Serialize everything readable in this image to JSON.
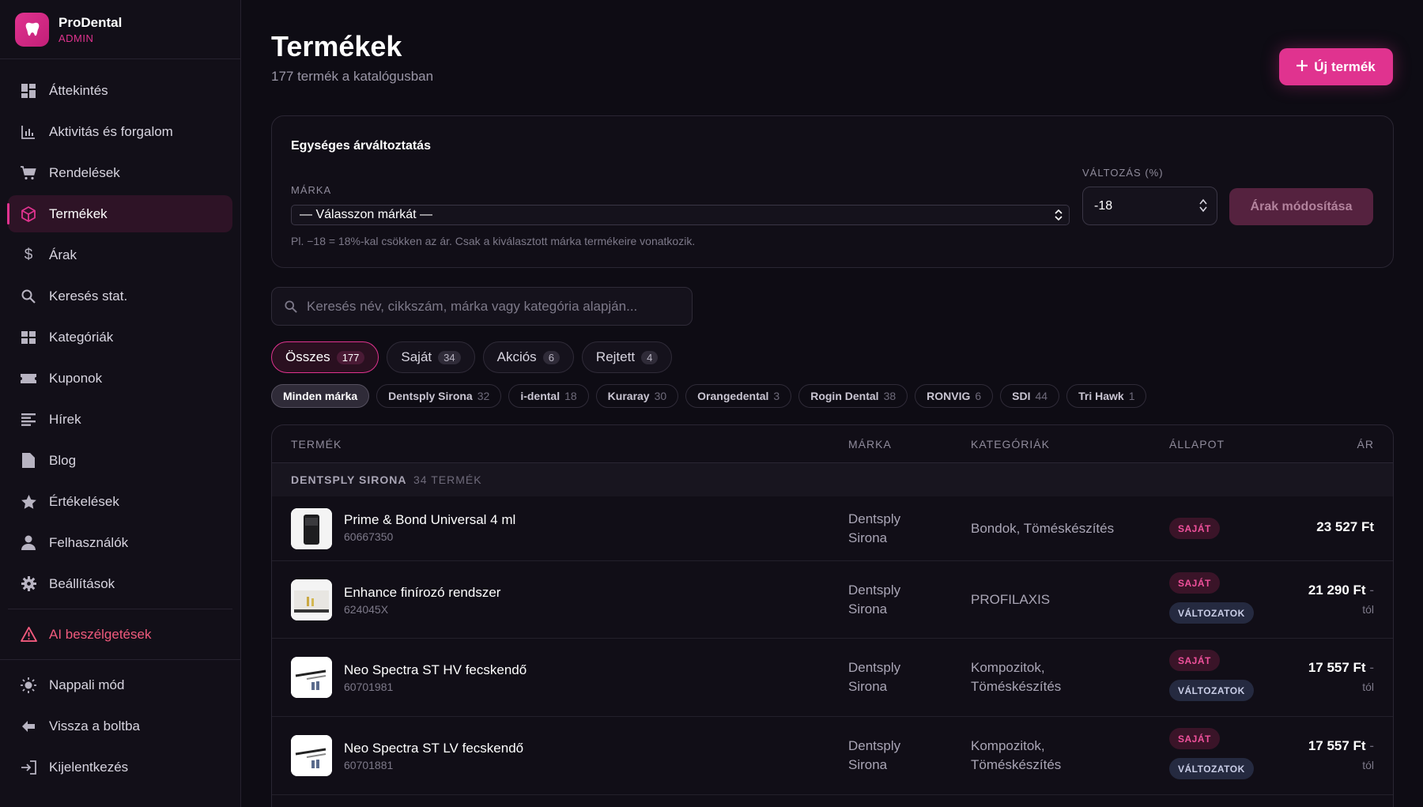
{
  "brand": {
    "name": "ProDental",
    "sub": "ADMIN"
  },
  "nav": [
    {
      "label": "Áttekintés",
      "icon": "dashboard-icon"
    },
    {
      "label": "Aktivitás és forgalom",
      "icon": "bar-chart-icon"
    },
    {
      "label": "Rendelések",
      "icon": "cart-icon"
    },
    {
      "label": "Termékek",
      "icon": "box-icon",
      "active": true
    },
    {
      "label": "Árak",
      "icon": "dollar-icon"
    },
    {
      "label": "Keresés stat.",
      "icon": "search-icon"
    },
    {
      "label": "Kategóriák",
      "icon": "grid-icon"
    },
    {
      "label": "Kuponok",
      "icon": "ticket-icon"
    },
    {
      "label": "Hírek",
      "icon": "news-icon"
    },
    {
      "label": "Blog",
      "icon": "document-icon"
    },
    {
      "label": "Értékelések",
      "icon": "star-icon"
    },
    {
      "label": "Felhasználók",
      "icon": "user-icon"
    },
    {
      "label": "Beállítások",
      "icon": "gear-icon"
    }
  ],
  "nav_ai": {
    "label": "AI beszélgetések",
    "icon": "warning-icon"
  },
  "nav_bottom": [
    {
      "label": "Nappali mód",
      "icon": "sun-icon"
    },
    {
      "label": "Vissza a boltba",
      "icon": "arrow-left-icon"
    },
    {
      "label": "Kijelentkezés",
      "icon": "logout-icon"
    }
  ],
  "header": {
    "title": "Termékek",
    "subtitle": "177 termék a katalógusban",
    "new_button": "Új termék"
  },
  "bulk": {
    "title": "Egységes árváltoztatás",
    "brand_label": "MÁRKA",
    "brand_value": "— Válasszon márkát —",
    "change_label": "VÁLTOZÁS (%)",
    "change_value": "-18",
    "apply_button": "Árak módosítása",
    "hint": "Pl. −18 = 18%-kal csökken az ár. Csak a kiválasztott márka termékeire vonatkozik."
  },
  "search": {
    "placeholder": "Keresés név, cikkszám, márka vagy kategória alapján..."
  },
  "tabs": [
    {
      "label": "Összes",
      "count": "177",
      "active": true
    },
    {
      "label": "Saját",
      "count": "34"
    },
    {
      "label": "Akciós",
      "count": "6"
    },
    {
      "label": "Rejtett",
      "count": "4"
    }
  ],
  "brand_chips": [
    {
      "label": "Minden márka",
      "count": "",
      "active": true
    },
    {
      "label": "Dentsply Sirona",
      "count": "32"
    },
    {
      "label": "i-dental",
      "count": "18"
    },
    {
      "label": "Kuraray",
      "count": "30"
    },
    {
      "label": "Orangedental",
      "count": "3"
    },
    {
      "label": "Rogin Dental",
      "count": "38"
    },
    {
      "label": "RONVIG",
      "count": "6"
    },
    {
      "label": "SDI",
      "count": "44"
    },
    {
      "label": "Tri Hawk",
      "count": "1"
    }
  ],
  "table": {
    "headers": {
      "product": "TERMÉK",
      "brand": "MÁRKA",
      "categories": "KATEGÓRIÁK",
      "status": "ÁLLAPOT",
      "price": "ÁR"
    },
    "group": {
      "name": "DENTSPLY SIRONA",
      "count": "34 TERMÉK"
    },
    "rows": [
      {
        "name": "Prime & Bond Universal 4 ml",
        "sku": "60667350",
        "brand_l1": "Dentsply",
        "brand_l2": "Sirona",
        "cat_l1": "Bondok, Töméskészítés",
        "cat_l2": "",
        "badge_own": "SAJÁT",
        "badge_var": "",
        "price": "23 527 Ft",
        "price_dash": "",
        "price_from": ""
      },
      {
        "name": "Enhance finírozó rendszer",
        "sku": "624045X",
        "brand_l1": "Dentsply",
        "brand_l2": "Sirona",
        "cat_l1": "PROFILAXIS",
        "cat_l2": "",
        "badge_own": "SAJÁT",
        "badge_var": "VÁLTOZATOK",
        "price": "21 290 Ft",
        "price_dash": "-",
        "price_from": "tól"
      },
      {
        "name": "Neo Spectra ST HV fecskendő",
        "sku": "60701981",
        "brand_l1": "Dentsply",
        "brand_l2": "Sirona",
        "cat_l1": "Kompozitok,",
        "cat_l2": "Töméskészítés",
        "badge_own": "SAJÁT",
        "badge_var": "VÁLTOZATOK",
        "price": "17 557 Ft",
        "price_dash": "-",
        "price_from": "tól"
      },
      {
        "name": "Neo Spectra ST LV fecskendő",
        "sku": "60701881",
        "brand_l1": "Dentsply",
        "brand_l2": "Sirona",
        "cat_l1": "Kompozitok,",
        "cat_l2": "Töméskészítés",
        "badge_own": "SAJÁT",
        "badge_var": "VÁLTOZATOK",
        "price": "17 557 Ft",
        "price_dash": "-",
        "price_from": "tól"
      }
    ]
  },
  "colors": {
    "accent": "#e0338f",
    "background": "#0e0c14",
    "sidebar": "#120f18"
  }
}
